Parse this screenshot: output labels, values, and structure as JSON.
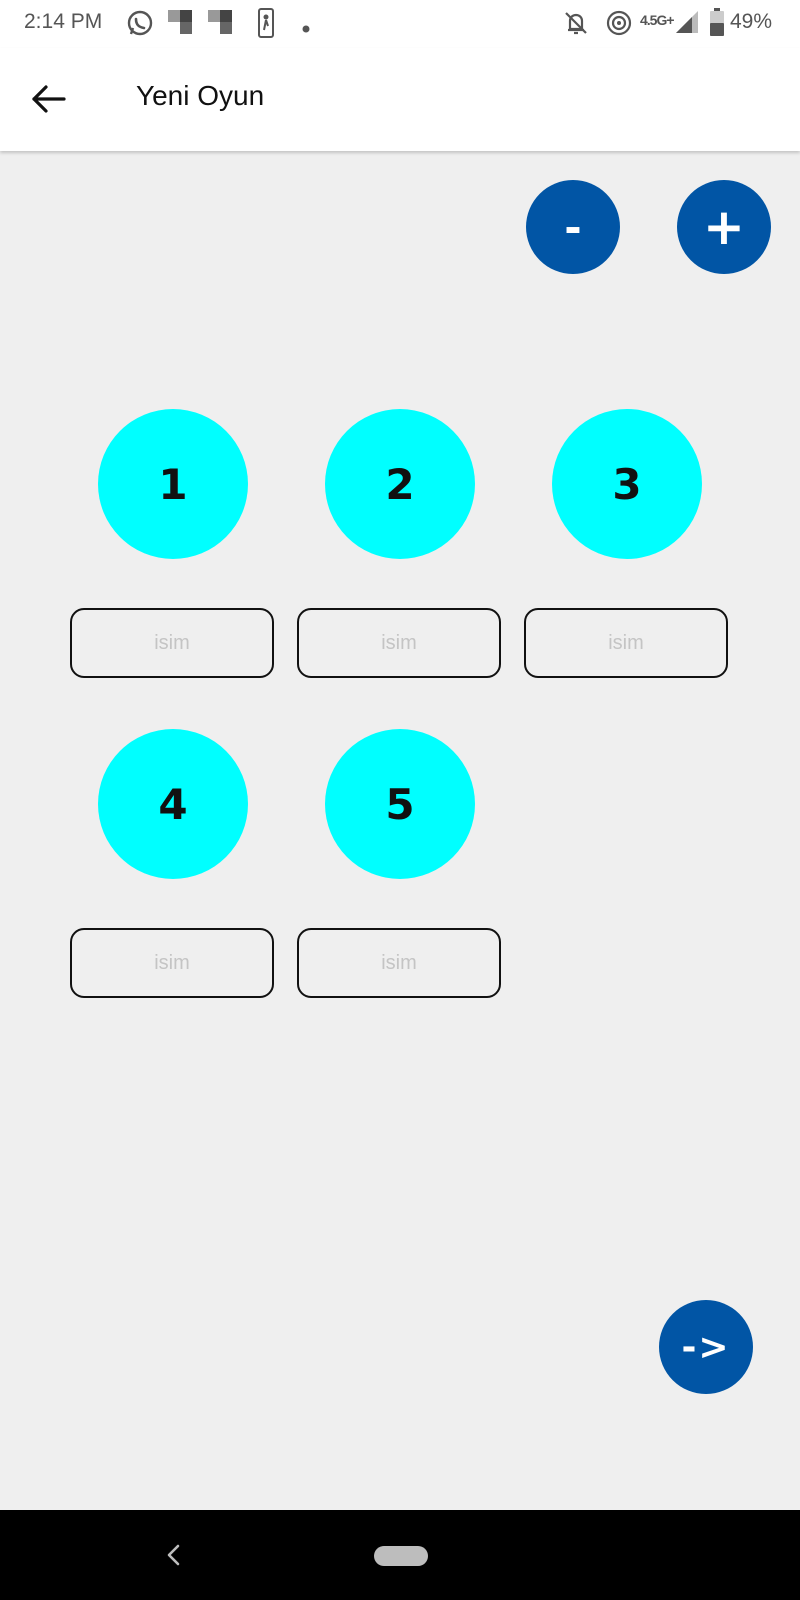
{
  "status_bar": {
    "time": "2:14 PM",
    "network": "4.5G+",
    "battery": "49%",
    "icons": [
      "whatsapp-icon",
      "notification-icon",
      "notification-icon",
      "nba-icon",
      "dot-icon",
      "bell-off-icon",
      "hotspot-icon",
      "signal-icon",
      "battery-icon"
    ]
  },
  "app_bar": {
    "title": "Yeni Oyun",
    "back_icon": "arrow-left-icon"
  },
  "controls": {
    "minus_label": "-",
    "plus_label": "+"
  },
  "players": [
    {
      "number": "1",
      "name_placeholder": "isim",
      "name_value": ""
    },
    {
      "number": "2",
      "name_placeholder": "isim",
      "name_value": ""
    },
    {
      "number": "3",
      "name_placeholder": "isim",
      "name_value": ""
    },
    {
      "number": "4",
      "name_placeholder": "isim",
      "name_value": ""
    },
    {
      "number": "5",
      "name_placeholder": "isim",
      "name_value": ""
    }
  ],
  "next_button": {
    "label": "->"
  },
  "colors": {
    "accent_blue": "#0155a5",
    "player_circle": "#00ffff",
    "background": "#efefef"
  }
}
